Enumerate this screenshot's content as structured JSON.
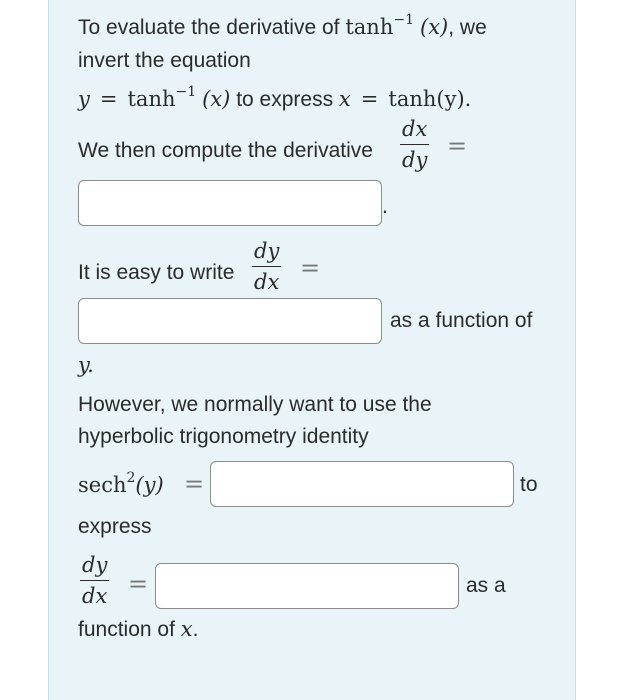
{
  "line1": {
    "text_a": "To evaluate the derivative of ",
    "func": "tanh",
    "sup": "−1",
    "arg": "(x)",
    "text_b": ", we"
  },
  "line2": "invert the equation",
  "line3": {
    "lhs": "y",
    "eq": "=",
    "func": "tanh",
    "sup": "−1",
    "arg": "(x)",
    "text": " to express ",
    "var": "x",
    "eq2": "=",
    "rhs": "tanh(y)."
  },
  "line4": {
    "text": "We then compute the derivative",
    "num": "dx",
    "den": "dy",
    "eq": "="
  },
  "box1_suffix": ".",
  "line5": {
    "text": "It is easy to write",
    "num": "dy",
    "den": "dx",
    "eq": "="
  },
  "box2_suffix": "as a function of",
  "line6": "y.",
  "line7": "However, we normally want to use the",
  "line8": "hyperbolic trigonometry identity",
  "identity": {
    "func": "sech",
    "sup": "2",
    "arg": "(y)",
    "eq": "=",
    "suffix": "to"
  },
  "line9": "express",
  "final": {
    "num": "dy",
    "den": "dx",
    "eq": "=",
    "suffix": "as a"
  },
  "line10": {
    "text": "function of ",
    "var": "x",
    "end": "."
  }
}
